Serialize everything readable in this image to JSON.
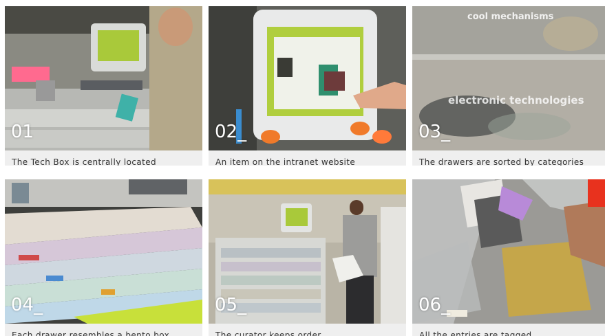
{
  "tiles": [
    {
      "number": "01",
      "caption": "The Tech Box is centrally located"
    },
    {
      "number": "02_",
      "caption": "An item on the intranet website"
    },
    {
      "number": "03_",
      "caption": "The drawers are sorted by categories",
      "overlay_top": "cool mechanisms",
      "overlay_bottom": "electronic technologies"
    },
    {
      "number": "04_",
      "caption": "Each drawer resembles a bento box"
    },
    {
      "number": "05_",
      "caption": "The curator keeps order"
    },
    {
      "number": "06_",
      "caption": "All the entries are tagged"
    }
  ]
}
